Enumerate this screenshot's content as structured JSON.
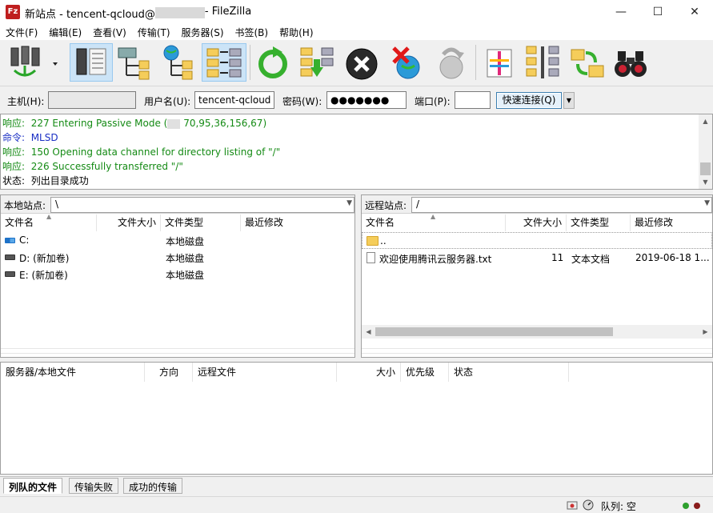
{
  "window": {
    "title_prefix": "新站点 - tencent-qcloud@",
    "title_suffix": " - FileZilla",
    "app_icon": "Fz",
    "minimize": "—",
    "maximize": "☐",
    "close": "✕"
  },
  "menu": [
    "文件(F)",
    "编辑(E)",
    "查看(V)",
    "传输(T)",
    "服务器(S)",
    "书签(B)",
    "帮助(H)"
  ],
  "quickconnect": {
    "host_label": "主机(H):",
    "host_value": "masked",
    "user_label": "用户名(U):",
    "user_value": "tencent-qcloud",
    "pass_label": "密码(W):",
    "pass_value": "●●●●●●●",
    "port_label": "端口(P):",
    "port_value": "",
    "connect_label": "快速连接(Q)",
    "dropdown": "▼"
  },
  "log": [
    {
      "kind": "响应:",
      "text": "227 Entering Passive Mode (",
      "ip": "",
      "text2": "70,95,36,156,67)",
      "color": "green"
    },
    {
      "kind": "命令:",
      "text": "MLSD",
      "color": "blue"
    },
    {
      "kind": "响应:",
      "text": "150 Opening data channel for directory listing of \"/\"",
      "color": "green"
    },
    {
      "kind": "响应:",
      "text": "226 Successfully transferred \"/\"",
      "color": "green"
    },
    {
      "kind": "状态:",
      "text": "列出目录成功",
      "color": "black"
    }
  ],
  "local": {
    "site_label": "本地站点:",
    "path": "\\",
    "columns": [
      "文件名",
      "文件大小",
      "文件类型",
      "最近修改"
    ],
    "rows": [
      {
        "name": "C:",
        "type": "本地磁盘"
      },
      {
        "name": "D: (新加卷)",
        "type": "本地磁盘"
      },
      {
        "name": "E: (新加卷)",
        "type": "本地磁盘"
      }
    ]
  },
  "remote": {
    "site_label": "远程站点:",
    "path": "/",
    "columns": [
      "文件名",
      "文件大小",
      "文件类型",
      "最近修改"
    ],
    "rows": [
      {
        "name": "..",
        "size": "",
        "type": "",
        "modified": ""
      },
      {
        "name": "欢迎使用腾讯云服务器.txt",
        "size": "11",
        "type": "文本文档",
        "modified": "2019-06-18 1..."
      }
    ]
  },
  "queue": {
    "columns": [
      "服务器/本地文件",
      "方向",
      "远程文件",
      "大小",
      "优先级",
      "状态"
    ]
  },
  "tabs": [
    "列队的文件",
    "传输失败",
    "成功的传输"
  ],
  "status": {
    "queue_label": "队列: 空"
  },
  "colors": {
    "log_blue": "#1a2fc4",
    "log_green": "#148a14",
    "accent": "#cce4f7"
  }
}
